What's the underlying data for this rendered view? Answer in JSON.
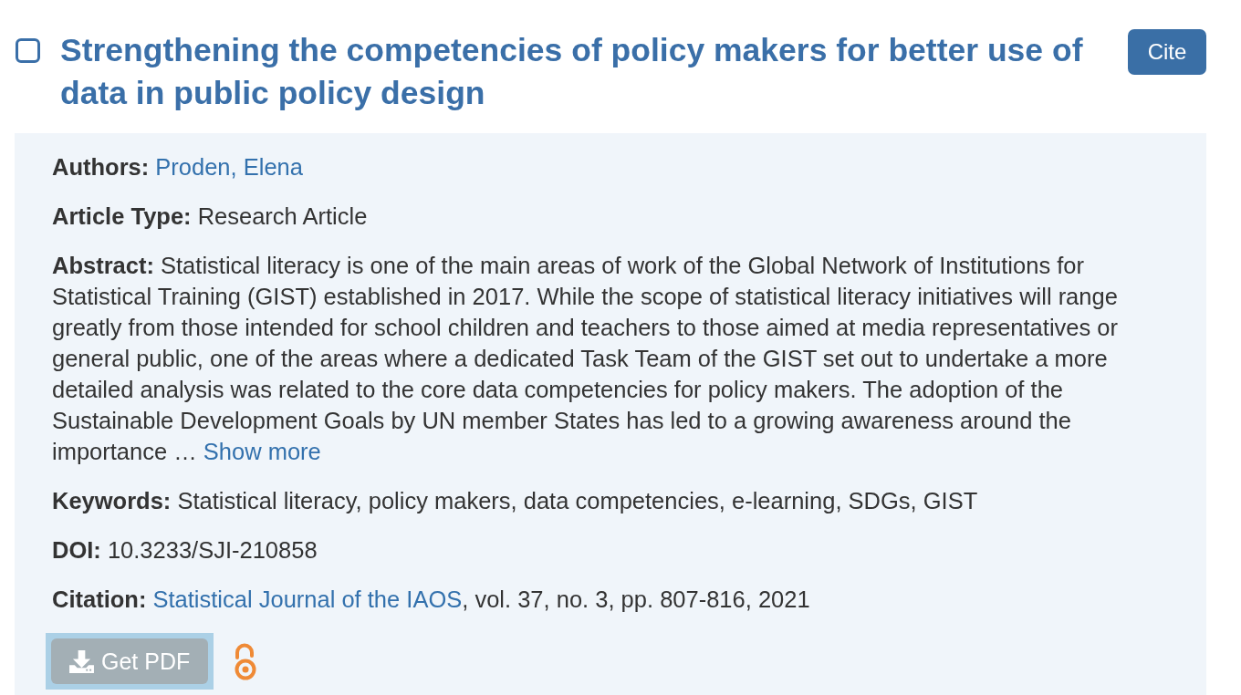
{
  "result": {
    "checked": false,
    "title": "Strengthening the competencies of policy makers for better use of data in public policy design",
    "cite_button": "Cite",
    "authors": {
      "label": "Authors:",
      "names": [
        "Proden, Elena"
      ]
    },
    "article_type": {
      "label": "Article Type:",
      "value": "Research Article"
    },
    "abstract": {
      "label": "Abstract:",
      "value": "Statistical literacy is one of the main areas of work of the Global Network of Institutions for Statistical Training (GIST) established in 2017. While the scope of statistical literacy initiatives will range greatly from those intended for school children and teachers to those aimed at media representatives or general public, one of the areas where a dedicated Task Team of the GIST set out to undertake a more detailed analysis was related to the core data competencies for policy makers. The adoption of the Sustainable Development Goals by UN member States has led to a growing awareness around the importance …",
      "show_more": "Show more"
    },
    "keywords": {
      "label": "Keywords:",
      "value": "Statistical literacy, policy makers, data competencies, e-learning, SDGs, GIST"
    },
    "doi": {
      "label": "DOI:",
      "value": "10.3233/SJI-210858"
    },
    "citation": {
      "label": "Citation:",
      "journal": "Statistical Journal of the IAOS",
      "details": ", vol. 37, no. 3, pp. 807-816, 2021"
    },
    "pdf_button": {
      "label": "Get PDF",
      "focused": true
    }
  }
}
